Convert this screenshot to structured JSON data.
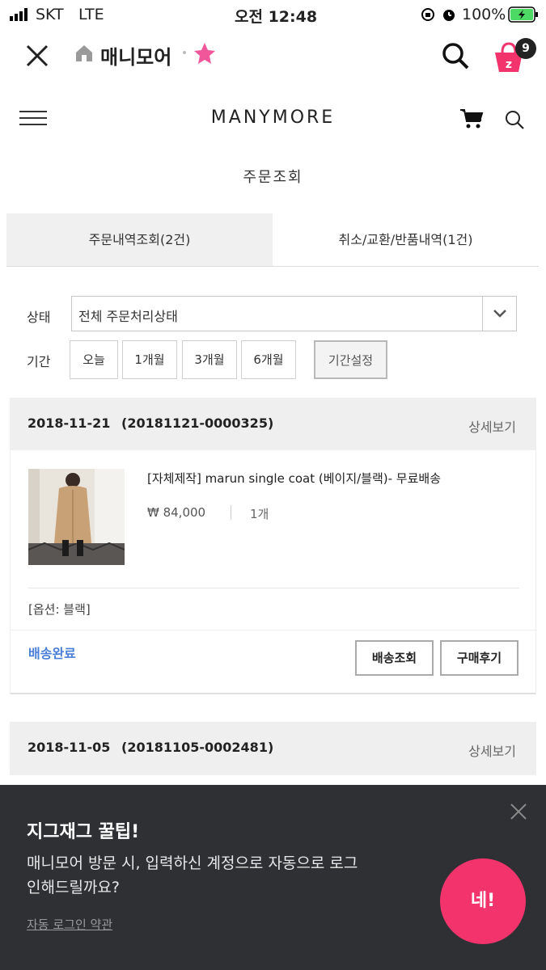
{
  "status_bar": {
    "carrier": "SKT",
    "network": "LTE",
    "time": "오전 12:48",
    "battery": "100%"
  },
  "app_bar": {
    "store_name": "매니모어",
    "cart_count": "9"
  },
  "shop_header": {
    "brand": "MANYMORE"
  },
  "page": {
    "title": "주문조회"
  },
  "tabs": [
    {
      "label": "주문내역조회(2건)",
      "active": true
    },
    {
      "label": "취소/교환/반품내역(1건)",
      "active": false
    }
  ],
  "filters": {
    "status_label": "상태",
    "status_value": "전체 주문처리상태",
    "period_label": "기간",
    "periods": [
      "오늘",
      "1개월",
      "3개월",
      "6개월"
    ],
    "custom_period": "기간설정"
  },
  "orders": [
    {
      "date": "2018-11-21",
      "number": "(20181121-0000325)",
      "detail": "상세보기",
      "product_name": "[자체제작] marun single coat (베이지/블랙)- 무료배송",
      "price": "₩ 84,000",
      "quantity": "1개",
      "option": "[옵션: 블랙]",
      "shipping_status": "배송완료",
      "actions": [
        "배송조회",
        "구매후기"
      ]
    },
    {
      "date": "2018-11-05",
      "number": "(20181105-0002481)",
      "detail": "상세보기"
    }
  ],
  "toast": {
    "title": "지그재그 꿀팁!",
    "message": "매니모어 방문 시, 입력하신 계정으로 자동으로 로그인해드릴까요?",
    "link": "자동 로그인 약관",
    "confirm": "네!"
  },
  "colors": {
    "accent_pink": "#f2336c",
    "status_blue": "#4a7fd8",
    "star": "#f0569a"
  }
}
